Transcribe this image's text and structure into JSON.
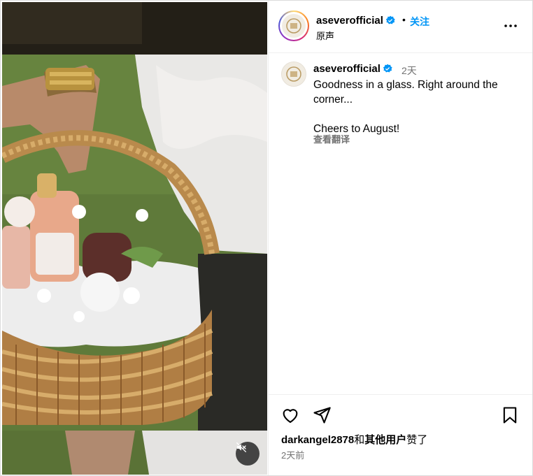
{
  "post": {
    "username": "aseverofficial",
    "separator": "•",
    "follow_label": "关注",
    "audio_label": "原声"
  },
  "caption": {
    "username": "aseverofficial",
    "time": "2天",
    "text": "Goodness in a glass. Right around the corner...\n\nCheers to August!",
    "translate_label": "查看翻译"
  },
  "engagement": {
    "liker": "darkangel2878",
    "connector": "和",
    "others": "其他用户",
    "suffix": "赞了",
    "posted_ago": "2天前"
  },
  "icons": {
    "verified": "verified-badge-icon",
    "more": "more-options-icon",
    "like": "heart-icon",
    "share": "send-icon",
    "save": "bookmark-icon",
    "mute": "speaker-muted-icon"
  },
  "colors": {
    "accent": "#0095f6",
    "secondary_text": "#737373",
    "border": "#dbdbdb"
  }
}
